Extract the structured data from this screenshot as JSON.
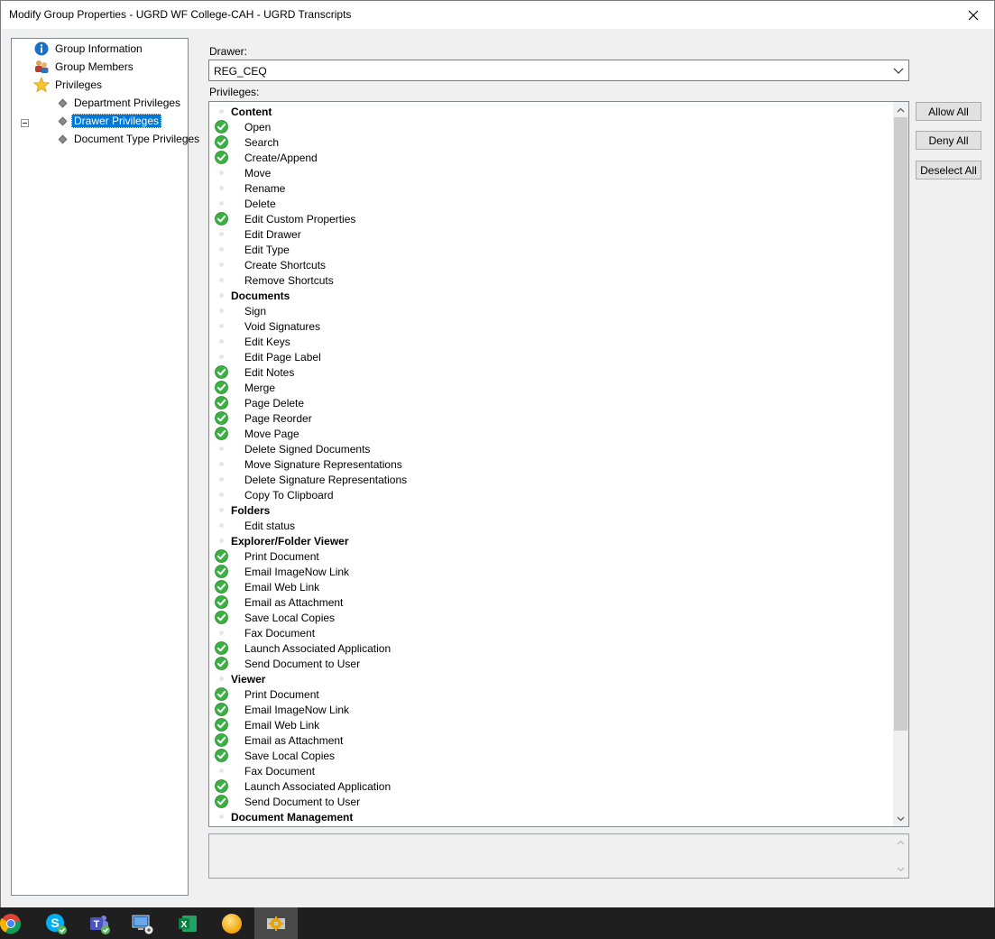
{
  "window": {
    "title": "Modify Group Properties - UGRD WF College-CAH - UGRD Transcripts"
  },
  "tree": {
    "items": [
      {
        "label": "Group Information",
        "icon": "info-icon"
      },
      {
        "label": "Group Members",
        "icon": "group-members-icon"
      },
      {
        "label": "Privileges",
        "icon": "star-icon"
      },
      {
        "label": "Department Privileges",
        "icon": "diamond-icon"
      },
      {
        "label": "Drawer Privileges",
        "icon": "diamond-icon",
        "selected": true
      },
      {
        "label": "Document Type Privileges",
        "icon": "diamond-icon"
      }
    ]
  },
  "drawer": {
    "label": "Drawer:",
    "value": "REG_CEQ"
  },
  "privileges": {
    "label": "Privileges:",
    "rows": [
      {
        "type": "group",
        "label": "Content",
        "allowed": false
      },
      {
        "type": "item",
        "label": "Open",
        "allowed": true
      },
      {
        "type": "item",
        "label": "Search",
        "allowed": true
      },
      {
        "type": "item",
        "label": "Create/Append",
        "allowed": true
      },
      {
        "type": "item",
        "label": "Move",
        "allowed": false
      },
      {
        "type": "item",
        "label": "Rename",
        "allowed": false
      },
      {
        "type": "item",
        "label": "Delete",
        "allowed": false
      },
      {
        "type": "item",
        "label": "Edit Custom Properties",
        "allowed": true
      },
      {
        "type": "item",
        "label": "Edit Drawer",
        "allowed": false
      },
      {
        "type": "item",
        "label": "Edit Type",
        "allowed": false
      },
      {
        "type": "item",
        "label": "Create Shortcuts",
        "allowed": false
      },
      {
        "type": "item",
        "label": "Remove Shortcuts",
        "allowed": false
      },
      {
        "type": "group",
        "label": "Documents",
        "allowed": false
      },
      {
        "type": "item",
        "label": "Sign",
        "allowed": false
      },
      {
        "type": "item",
        "label": "Void Signatures",
        "allowed": false
      },
      {
        "type": "item",
        "label": "Edit Keys",
        "allowed": false
      },
      {
        "type": "item",
        "label": "Edit Page Label",
        "allowed": false
      },
      {
        "type": "item",
        "label": "Edit Notes",
        "allowed": true
      },
      {
        "type": "item",
        "label": "Merge",
        "allowed": true
      },
      {
        "type": "item",
        "label": "Page Delete",
        "allowed": true
      },
      {
        "type": "item",
        "label": "Page Reorder",
        "allowed": true
      },
      {
        "type": "item",
        "label": "Move Page",
        "allowed": true
      },
      {
        "type": "item",
        "label": "Delete Signed Documents",
        "allowed": false
      },
      {
        "type": "item",
        "label": "Move Signature Representations",
        "allowed": false
      },
      {
        "type": "item",
        "label": "Delete Signature Representations",
        "allowed": false
      },
      {
        "type": "item",
        "label": "Copy To Clipboard",
        "allowed": false
      },
      {
        "type": "group",
        "label": "Folders",
        "allowed": false
      },
      {
        "type": "item",
        "label": "Edit status",
        "allowed": false
      },
      {
        "type": "group",
        "label": "Explorer/Folder Viewer",
        "allowed": false
      },
      {
        "type": "item",
        "label": "Print Document",
        "allowed": true
      },
      {
        "type": "item",
        "label": "Email ImageNow Link",
        "allowed": true
      },
      {
        "type": "item",
        "label": "Email Web Link",
        "allowed": true
      },
      {
        "type": "item",
        "label": "Email as Attachment",
        "allowed": true
      },
      {
        "type": "item",
        "label": "Save Local Copies",
        "allowed": true
      },
      {
        "type": "item",
        "label": "Fax Document",
        "allowed": false
      },
      {
        "type": "item",
        "label": "Launch Associated Application",
        "allowed": true
      },
      {
        "type": "item",
        "label": "Send Document to User",
        "allowed": true
      },
      {
        "type": "group",
        "label": "Viewer",
        "allowed": false
      },
      {
        "type": "item",
        "label": "Print Document",
        "allowed": true
      },
      {
        "type": "item",
        "label": "Email ImageNow Link",
        "allowed": true
      },
      {
        "type": "item",
        "label": "Email Web Link",
        "allowed": true
      },
      {
        "type": "item",
        "label": "Email as Attachment",
        "allowed": true
      },
      {
        "type": "item",
        "label": "Save Local Copies",
        "allowed": true
      },
      {
        "type": "item",
        "label": "Fax Document",
        "allowed": false
      },
      {
        "type": "item",
        "label": "Launch Associated Application",
        "allowed": true
      },
      {
        "type": "item",
        "label": "Send Document to User",
        "allowed": true
      },
      {
        "type": "group",
        "label": "Document Management",
        "allowed": false
      }
    ]
  },
  "buttons": {
    "allow_all": "Allow All",
    "deny_all": "Deny All",
    "deselect_all": "Deselect All"
  },
  "colors": {
    "check": "#3cb043",
    "selection": "#0078d7",
    "taskbar": "#1f1f1f"
  },
  "taskbar": {
    "icons": [
      "chrome-icon",
      "skype-icon",
      "teams-icon",
      "remote-desktop-icon",
      "excel-icon",
      "orange-ball-icon",
      "imagenow-gear-icon"
    ]
  }
}
